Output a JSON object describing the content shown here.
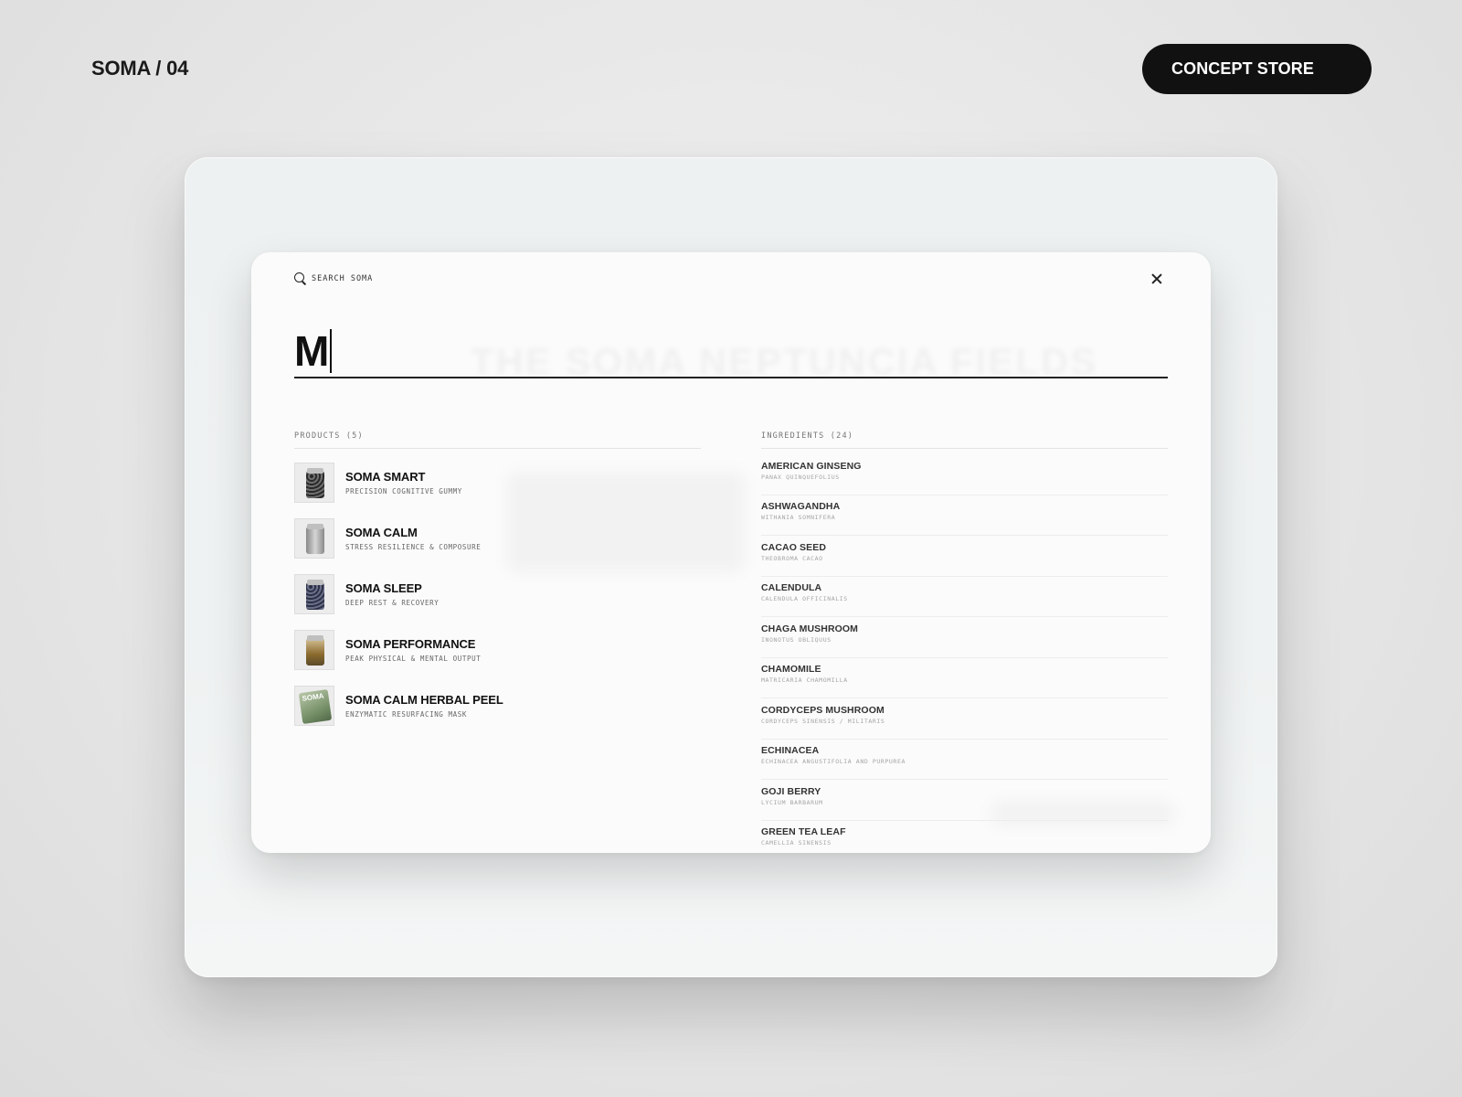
{
  "header": {
    "brand": "SOMA / 04",
    "store_button": "CONCEPT STORE"
  },
  "modal": {
    "search_label": "SEARCH SOMA",
    "query": "M",
    "background_heading": "THE SOMA NEPTUNCIA FIELDS"
  },
  "products": {
    "label": "PRODUCTS (5)",
    "items": [
      {
        "name": "SOMA SMART",
        "subtitle": "PRECISION COGNITIVE GUMMY",
        "thumb": "jar-smart"
      },
      {
        "name": "SOMA CALM",
        "subtitle": "STRESS RESILIENCE & COMPOSURE",
        "thumb": "jar-calm"
      },
      {
        "name": "SOMA SLEEP",
        "subtitle": "DEEP REST & RECOVERY",
        "thumb": "jar-sleep"
      },
      {
        "name": "SOMA PERFORMANCE",
        "subtitle": "PEAK PHYSICAL & MENTAL OUTPUT",
        "thumb": "jar-performance"
      },
      {
        "name": "SOMA CALM HERBAL PEEL",
        "subtitle": "ENZYMATIC RESURFACING MASK",
        "thumb": "pouch-peel",
        "thumb_text": "SOMA"
      }
    ]
  },
  "ingredients": {
    "label": "INGREDIENTS (24)",
    "items": [
      {
        "name": "AMERICAN GINSENG",
        "latin": "PANAX QUINQUEFOLIUS"
      },
      {
        "name": "ASHWAGANDHA",
        "latin": "WITHANIA SOMNIFERA"
      },
      {
        "name": "CACAO SEED",
        "latin": "THEOBROMA CACAO"
      },
      {
        "name": "CALENDULA",
        "latin": "CALENDULA OFFICINALIS"
      },
      {
        "name": "CHAGA MUSHROOM",
        "latin": "INONOTUS OBLIQUUS"
      },
      {
        "name": "CHAMOMILE",
        "latin": "MATRICARIA CHAMOMILLA"
      },
      {
        "name": "CORDYCEPS MUSHROOM",
        "latin": "CORDYCEPS SINENSIS / MILITARIS"
      },
      {
        "name": "ECHINACEA",
        "latin": "ECHINACEA ANGUSTIFOLIA AND PURPUREA"
      },
      {
        "name": "GOJI BERRY",
        "latin": "LYCIUM BARBARUM"
      },
      {
        "name": "GREEN TEA LEAF",
        "latin": "CAMELLIA SINENSIS"
      }
    ]
  },
  "icons": {
    "search": "search-icon",
    "close": "close-icon"
  }
}
